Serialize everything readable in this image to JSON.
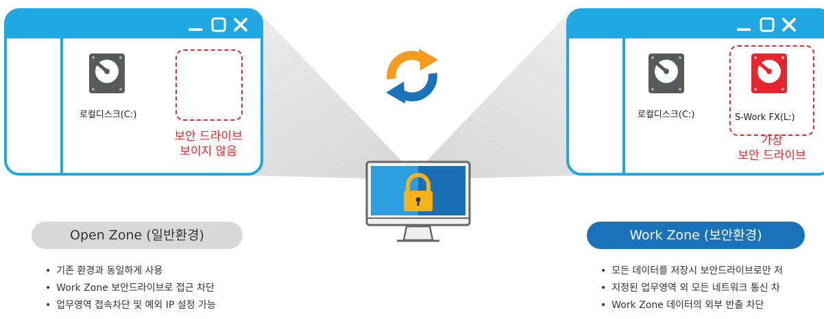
{
  "open_window": {
    "drive_label": "로컬디스크(C:)",
    "note": "보안 드라이브\n보이지 않음"
  },
  "work_window": {
    "drive_label": "로컬디스크(C:)",
    "secure_drive_label": "S-Work FX(L:)",
    "note": "가상\n보안 드라이브"
  },
  "open_zone": {
    "title": "Open Zone (일반환경)",
    "bullets": [
      "기존 환경과 동일하게 사용",
      "Work Zone 보안드라이브로 접근 차단",
      "업무영역 접속차단 및 예외 IP 설정 가능"
    ]
  },
  "work_zone": {
    "title": "Work Zone (보안환경)",
    "bullets": [
      "모든 데이터를 저장시 보안드라이브로만 저",
      "지정된 업무영역 외 모든 네트워크 통신 차",
      "Work Zone 데이터의 외부 반출 차단"
    ]
  },
  "colors": {
    "window_blue": "#1ea7e1",
    "alert_red": "#e5262d",
    "work_zone_blue": "#1a72b8",
    "open_zone_gray": "#d9d9d9",
    "sync_orange": "#f39c1d",
    "sync_blue": "#1a72b8",
    "lock_yellow": "#f6b21b"
  },
  "icons": [
    "minimize-icon",
    "maximize-icon",
    "close-icon",
    "hard-drive-icon",
    "sync-arrows-icon",
    "monitor-lock-icon"
  ]
}
